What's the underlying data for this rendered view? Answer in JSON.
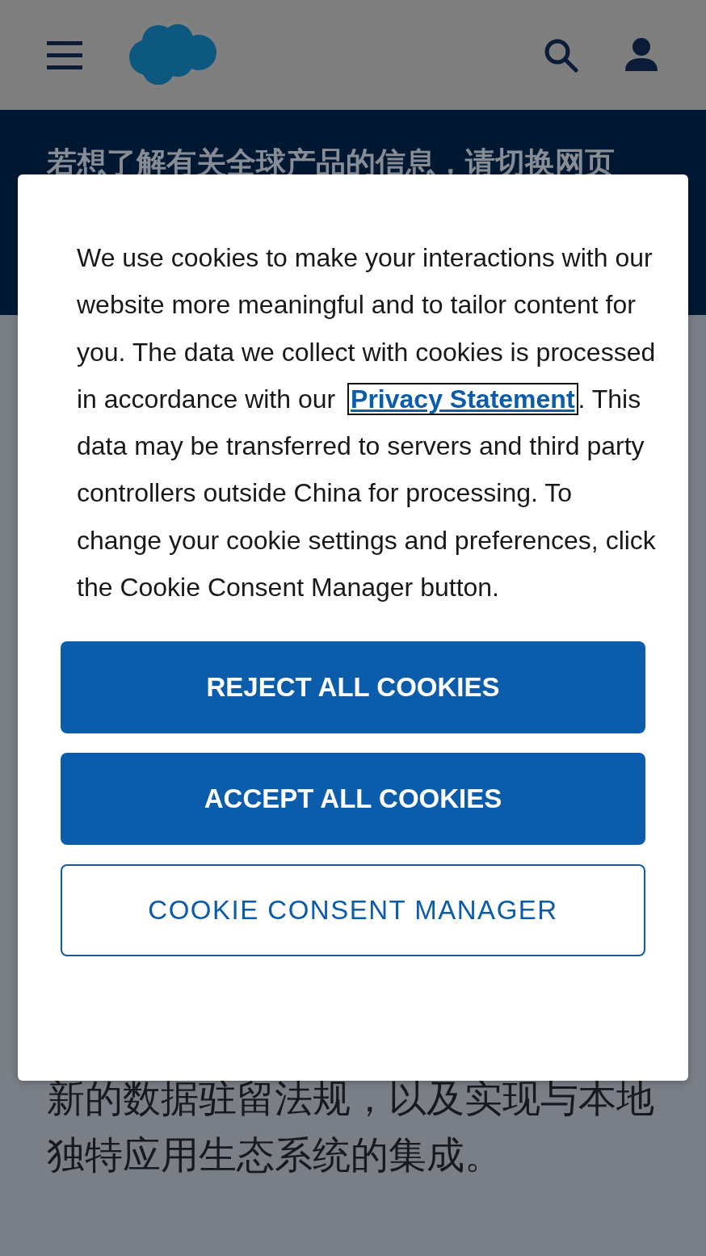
{
  "banner": {
    "text": "若想了解有关全球产品的信息，请切换网页"
  },
  "cookie_dialog": {
    "text_before": "We use cookies to make your interactions with our website more meaningful and to tailor content for you. The data we collect with cookies is processed in accordance with our ",
    "link": "Privacy Statement",
    "text_after": ". This data may be transferred to servers and third party controllers outside China for processing. To change your cookie settings and preferences, click the Cookie Consent Manager button.",
    "buttons": [
      {
        "label": "REJECT ALL COOKIES",
        "kind": "primary"
      },
      {
        "label": "ACCEPT ALL COOKIES",
        "kind": "primary"
      },
      {
        "label": "COOKIE CONSENT MANAGER",
        "kind": "outline"
      }
    ]
  },
  "body_text": "新的数据驻留法规，以及实现与本地独特应用生态系统的集成。"
}
